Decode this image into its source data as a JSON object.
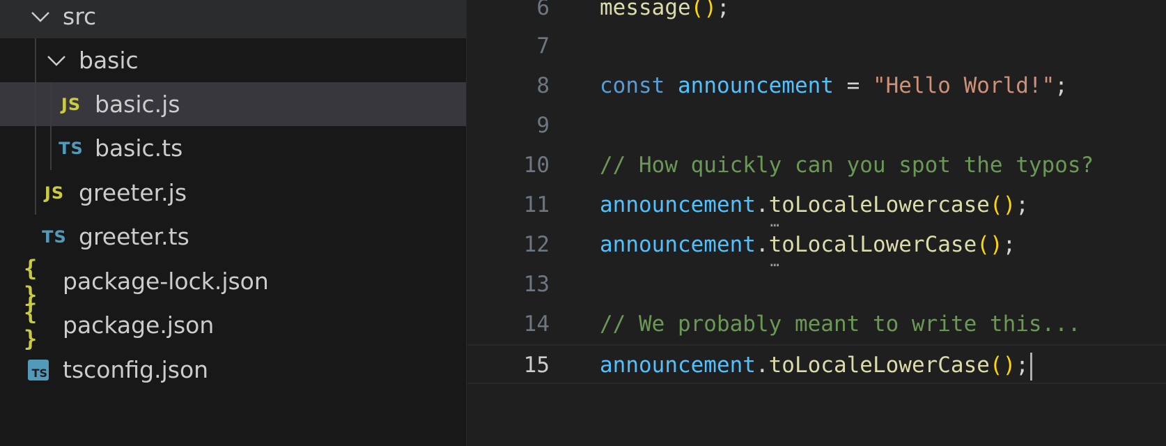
{
  "explorer": {
    "items": [
      {
        "label": "src",
        "icon": "chevron-down-icon"
      },
      {
        "label": "basic",
        "icon": "chevron-down-icon"
      },
      {
        "label": "basic.js",
        "icon": "js-file-icon",
        "badge": "JS",
        "selected": true
      },
      {
        "label": "basic.ts",
        "icon": "ts-file-icon",
        "badge": "TS"
      },
      {
        "label": "greeter.js",
        "icon": "js-file-icon",
        "badge": "JS"
      },
      {
        "label": "greeter.ts",
        "icon": "ts-file-icon",
        "badge": "TS"
      },
      {
        "label": "package-lock.json",
        "icon": "json-file-icon",
        "badge": "{ }"
      },
      {
        "label": "package.json",
        "icon": "json-file-icon",
        "badge": "{ }"
      },
      {
        "label": "tsconfig.json",
        "icon": "tsconfig-file-icon",
        "badge": "TS"
      }
    ]
  },
  "editor": {
    "current_line": "15",
    "lines": [
      {
        "no": "6",
        "parts": [
          "message",
          "(",
          ")",
          ";"
        ]
      },
      {
        "no": "7"
      },
      {
        "no": "8",
        "parts": [
          "const",
          " ",
          "announcement",
          " = ",
          "\"Hello World!\"",
          ";"
        ]
      },
      {
        "no": "9"
      },
      {
        "no": "10",
        "parts": [
          "// How quickly can you spot the typos?"
        ]
      },
      {
        "no": "11",
        "parts": [
          "announcement",
          ".",
          "to",
          "LocaleLowercase",
          "(",
          ")",
          ";"
        ]
      },
      {
        "no": "12",
        "parts": [
          "announcement",
          ".",
          "to",
          "LocalLowerCase",
          "(",
          ")",
          ";"
        ]
      },
      {
        "no": "13"
      },
      {
        "no": "14",
        "parts": [
          "// We probably meant to write this..."
        ]
      },
      {
        "no": "15",
        "parts": [
          "announcement",
          ".",
          "toLocaleLowerCase",
          "(",
          ")",
          ";"
        ]
      }
    ]
  },
  "colors": {
    "keyword": "#569cd6",
    "variable": "#4fc1ff",
    "function": "#dcdcaa",
    "string": "#ce9178",
    "comment": "#6a9955",
    "bracket": "#ffd700"
  }
}
